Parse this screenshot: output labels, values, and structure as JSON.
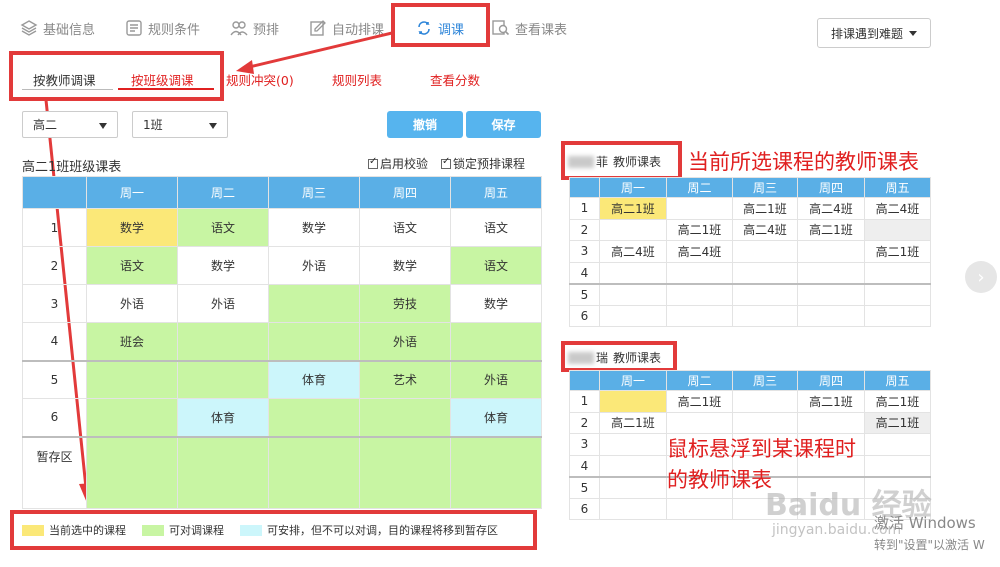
{
  "nav": {
    "items": [
      {
        "label": "基础信息",
        "icon": "layers-icon"
      },
      {
        "label": "规则条件",
        "icon": "rules-icon"
      },
      {
        "label": "预排",
        "icon": "people-icon"
      },
      {
        "label": "自动排课",
        "icon": "edit-icon"
      },
      {
        "label": "调课",
        "icon": "swap-icon"
      },
      {
        "label": "查看课表",
        "icon": "search-icon"
      }
    ],
    "active": "调课",
    "dropdown_label": "排课遇到难题"
  },
  "subtabs": {
    "by_teacher": "按教师调课",
    "by_class": "按班级调课",
    "conflict": "规则冲突(0)",
    "rule_list": "规则列表",
    "view_score": "查看分数"
  },
  "controls": {
    "grade": "高二",
    "class": "1班",
    "undo": "撤销",
    "save": "保存",
    "check_label": "启用校验",
    "lock_label": "锁定预排课程"
  },
  "class_table": {
    "title": "高二1班班级课表",
    "headers": [
      "",
      "周一",
      "周二",
      "周三",
      "周四",
      "周五"
    ],
    "rows": [
      {
        "period": "1",
        "cells": [
          "数学",
          "语文",
          "数学",
          "语文",
          "语文"
        ]
      },
      {
        "period": "2",
        "cells": [
          "语文",
          "数学",
          "外语",
          "数学",
          "语文"
        ]
      },
      {
        "period": "3",
        "cells": [
          "外语",
          "外语",
          "",
          "劳技",
          "数学"
        ]
      },
      {
        "period": "4",
        "cells": [
          "班会",
          "",
          "",
          "外语",
          ""
        ]
      },
      {
        "period": "5",
        "cells": [
          "",
          "",
          "体育",
          "艺术",
          "外语"
        ]
      },
      {
        "period": "6",
        "cells": [
          "",
          "体育",
          "",
          "",
          "体育"
        ]
      }
    ],
    "staging_label": "暂存区"
  },
  "legend": {
    "selected": "当前选中的课程",
    "swappable": "可对调课程",
    "arrangeable": "可安排，但不可以对调，目的课程将移到暂存区",
    "colors": {
      "selected": "#fbe878",
      "swappable": "#c8f5a3",
      "arrangeable": "#ccf6fb"
    }
  },
  "teacher_table_1": {
    "title_name": "菲",
    "title_suffix": "教师课表",
    "headers": [
      "",
      "周一",
      "周二",
      "周三",
      "周四",
      "周五"
    ],
    "rows": [
      {
        "period": "1",
        "cells": [
          "高二1班",
          "",
          "高二1班",
          "高二4班",
          "高二4班"
        ]
      },
      {
        "period": "2",
        "cells": [
          "",
          "高二1班",
          "高二4班",
          "高二1班",
          ""
        ]
      },
      {
        "period": "3",
        "cells": [
          "高二4班",
          "高二4班",
          "",
          "",
          "高二1班"
        ]
      },
      {
        "period": "4",
        "cells": [
          "",
          "",
          "",
          "",
          ""
        ]
      },
      {
        "period": "5",
        "cells": [
          "",
          "",
          "",
          "",
          ""
        ]
      },
      {
        "period": "6",
        "cells": [
          "",
          "",
          "",
          "",
          ""
        ]
      }
    ]
  },
  "teacher_table_2": {
    "title_name": "瑞",
    "title_suffix": "教师课表",
    "headers": [
      "",
      "周一",
      "周二",
      "周三",
      "周四",
      "周五"
    ],
    "rows": [
      {
        "period": "1",
        "cells": [
          "",
          "高二1班",
          "",
          "高二1班",
          "高二1班"
        ]
      },
      {
        "period": "2",
        "cells": [
          "高二1班",
          "",
          "",
          "",
          "高二1班"
        ]
      },
      {
        "period": "3",
        "cells": [
          "",
          "",
          "",
          "",
          ""
        ]
      },
      {
        "period": "4",
        "cells": [
          "",
          "",
          "",
          "",
          ""
        ]
      },
      {
        "period": "5",
        "cells": [
          "",
          "",
          "",
          "",
          ""
        ]
      },
      {
        "period": "6",
        "cells": [
          "",
          "",
          "",
          "",
          ""
        ]
      }
    ]
  },
  "annotations": {
    "teacher_current": "当前所选课程的教师课表",
    "hover_line1": "鼠标悬浮到某课程时",
    "hover_line2": "的教师课表"
  },
  "watermark": {
    "activate_line1": "激活 Windows",
    "activate_line2": "转到\"设置\"以激活 W",
    "site": "jingyan.baidu.com",
    "brand": "Baidu 经验"
  }
}
